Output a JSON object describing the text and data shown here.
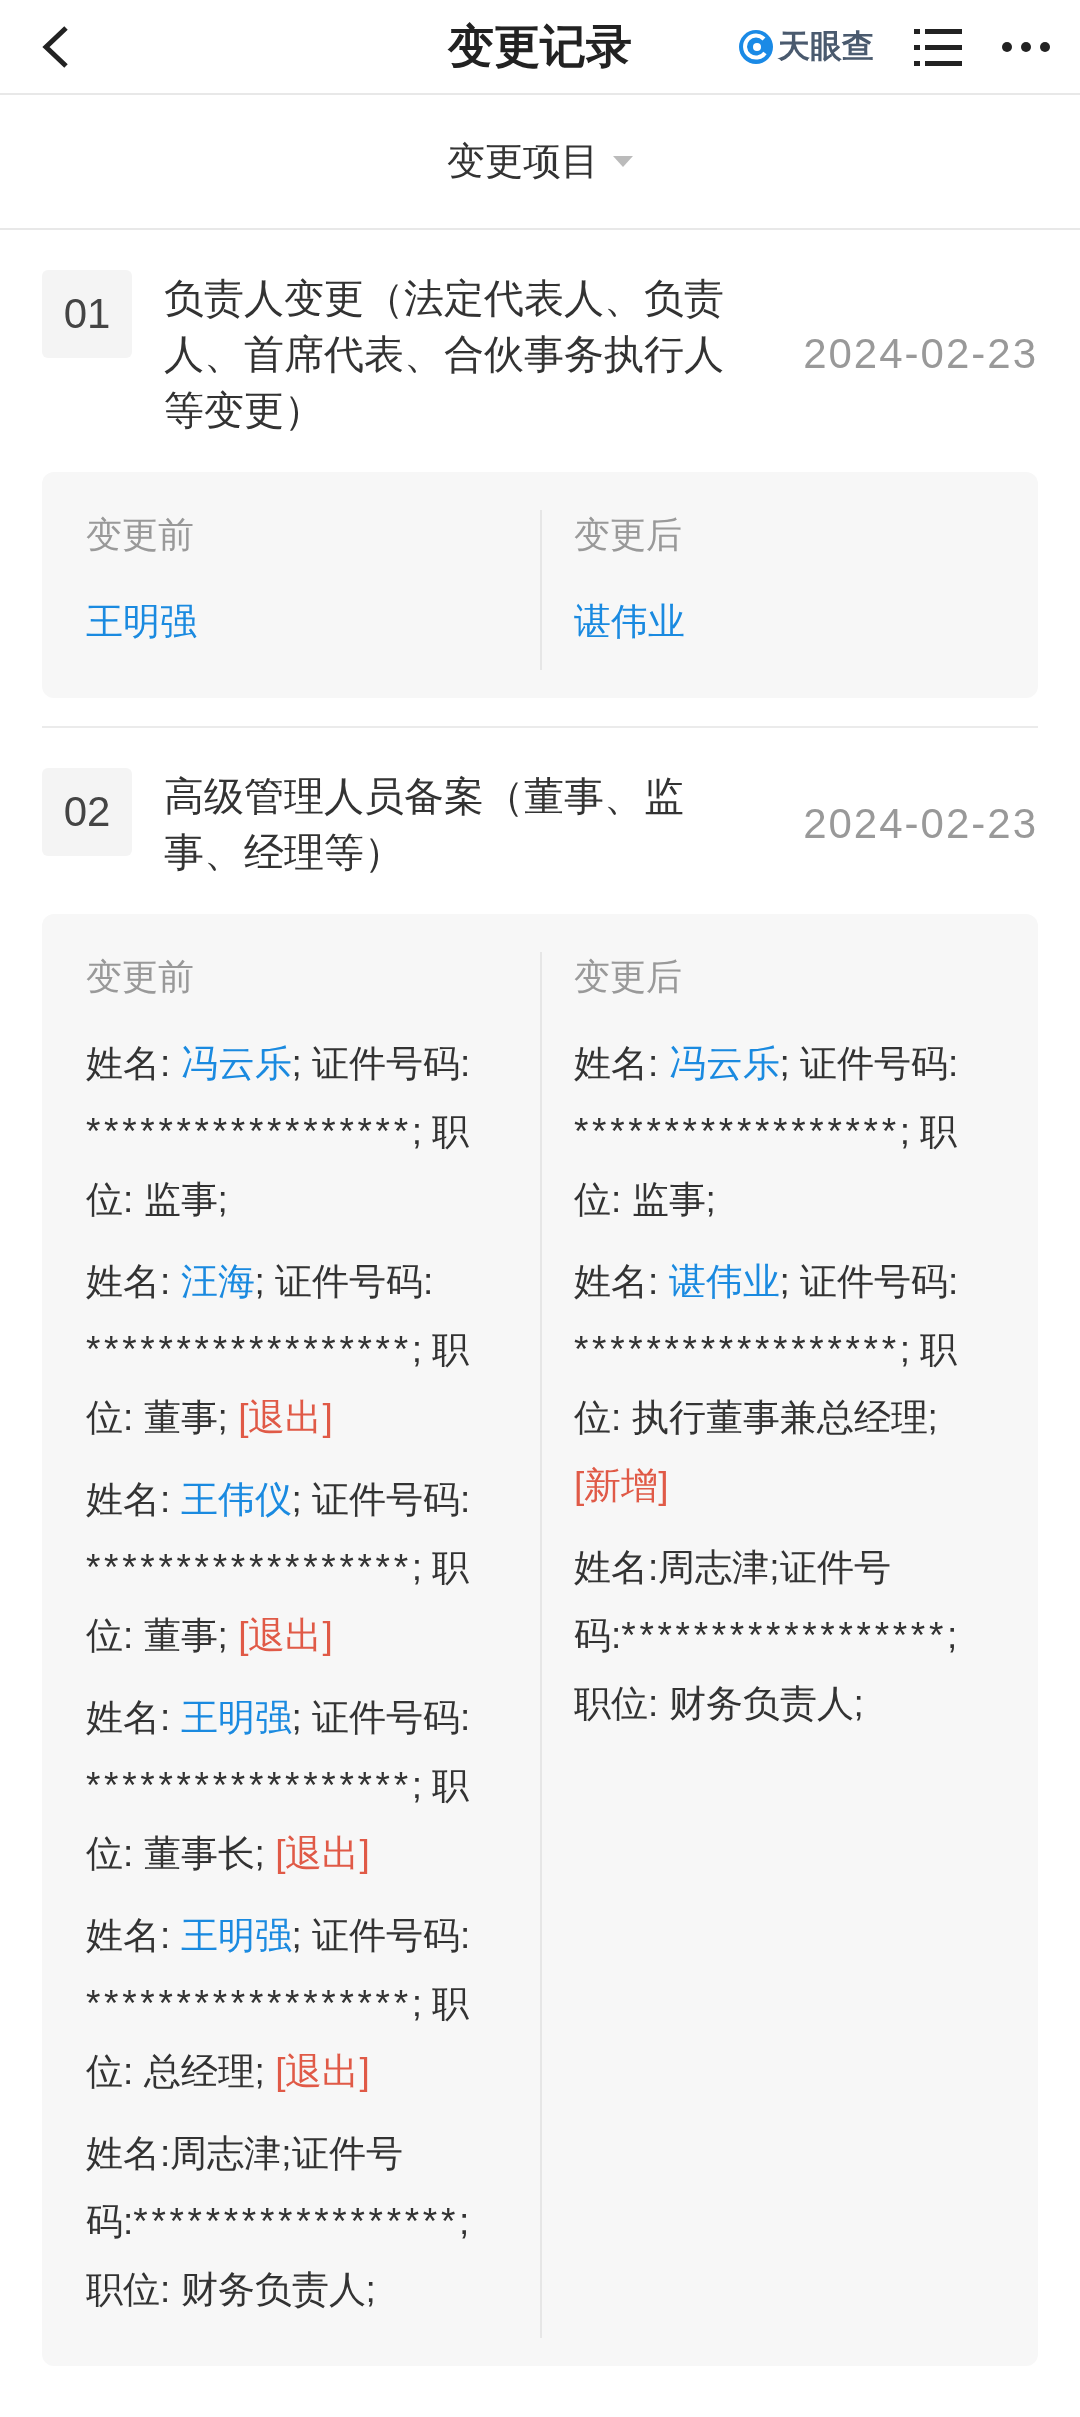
{
  "header": {
    "title": "变更记录",
    "logo_text": "天眼查"
  },
  "filter": {
    "label": "变更项目"
  },
  "records": [
    {
      "index": "01",
      "title": "负责人变更（法定代表人、负责人、首席代表、合伙事务执行人等变更）",
      "date": "2024-02-23",
      "before_label": "变更前",
      "after_label": "变更后",
      "before": [
        [
          {
            "kind": "name",
            "text": "王明强"
          }
        ]
      ],
      "after": [
        [
          {
            "kind": "name",
            "text": "谌伟业"
          }
        ]
      ]
    },
    {
      "index": "02",
      "title": "高级管理人员备案（董事、监事、经理等）",
      "date": "2024-02-23",
      "before_label": "变更前",
      "after_label": "变更后",
      "before": [
        [
          {
            "kind": "text",
            "text": "姓名: "
          },
          {
            "kind": "name",
            "text": "冯云乐"
          },
          {
            "kind": "text",
            "text": "; 证件号码: "
          },
          {
            "kind": "masked",
            "text": "******************"
          },
          {
            "kind": "text",
            "text": "; 职位: 监事;"
          }
        ],
        [
          {
            "kind": "text",
            "text": "姓名: "
          },
          {
            "kind": "name",
            "text": "汪海"
          },
          {
            "kind": "text",
            "text": "; 证件号码: "
          },
          {
            "kind": "masked",
            "text": "******************"
          },
          {
            "kind": "text",
            "text": "; 职位: 董事; "
          },
          {
            "kind": "tag",
            "text": "[退出]"
          }
        ],
        [
          {
            "kind": "text",
            "text": "姓名: "
          },
          {
            "kind": "name",
            "text": "王伟仪"
          },
          {
            "kind": "text",
            "text": "; 证件号码: "
          },
          {
            "kind": "masked",
            "text": "******************"
          },
          {
            "kind": "text",
            "text": "; 职位: 董事; "
          },
          {
            "kind": "tag",
            "text": "[退出]"
          }
        ],
        [
          {
            "kind": "text",
            "text": "姓名: "
          },
          {
            "kind": "name",
            "text": "王明强"
          },
          {
            "kind": "text",
            "text": "; 证件号码: "
          },
          {
            "kind": "masked",
            "text": "******************"
          },
          {
            "kind": "text",
            "text": "; 职位: 董事长; "
          },
          {
            "kind": "tag",
            "text": "[退出]"
          }
        ],
        [
          {
            "kind": "text",
            "text": "姓名: "
          },
          {
            "kind": "name",
            "text": "王明强"
          },
          {
            "kind": "text",
            "text": "; 证件号码: "
          },
          {
            "kind": "masked",
            "text": "******************"
          },
          {
            "kind": "text",
            "text": "; 职位: 总经理; "
          },
          {
            "kind": "tag",
            "text": "[退出]"
          }
        ],
        [
          {
            "kind": "text",
            "text": "姓名:周志津;证件号码:"
          },
          {
            "kind": "masked",
            "text": "******************"
          },
          {
            "kind": "text",
            "text": "; 职位: 财务负责人;"
          }
        ]
      ],
      "after": [
        [
          {
            "kind": "text",
            "text": "姓名: "
          },
          {
            "kind": "name",
            "text": "冯云乐"
          },
          {
            "kind": "text",
            "text": "; 证件号码: "
          },
          {
            "kind": "masked",
            "text": "******************"
          },
          {
            "kind": "text",
            "text": "; 职位: 监事;"
          }
        ],
        [
          {
            "kind": "text",
            "text": "姓名: "
          },
          {
            "kind": "name",
            "text": "谌伟业"
          },
          {
            "kind": "text",
            "text": "; 证件号码: "
          },
          {
            "kind": "masked",
            "text": "******************"
          },
          {
            "kind": "text",
            "text": "; 职位: 执行董事兼总经理; "
          },
          {
            "kind": "tag",
            "text": "[新增]"
          }
        ],
        [
          {
            "kind": "text",
            "text": "姓名:周志津;证件号码:"
          },
          {
            "kind": "masked",
            "text": "******************"
          },
          {
            "kind": "text",
            "text": "; 职位: 财务负责人;"
          }
        ]
      ]
    }
  ]
}
